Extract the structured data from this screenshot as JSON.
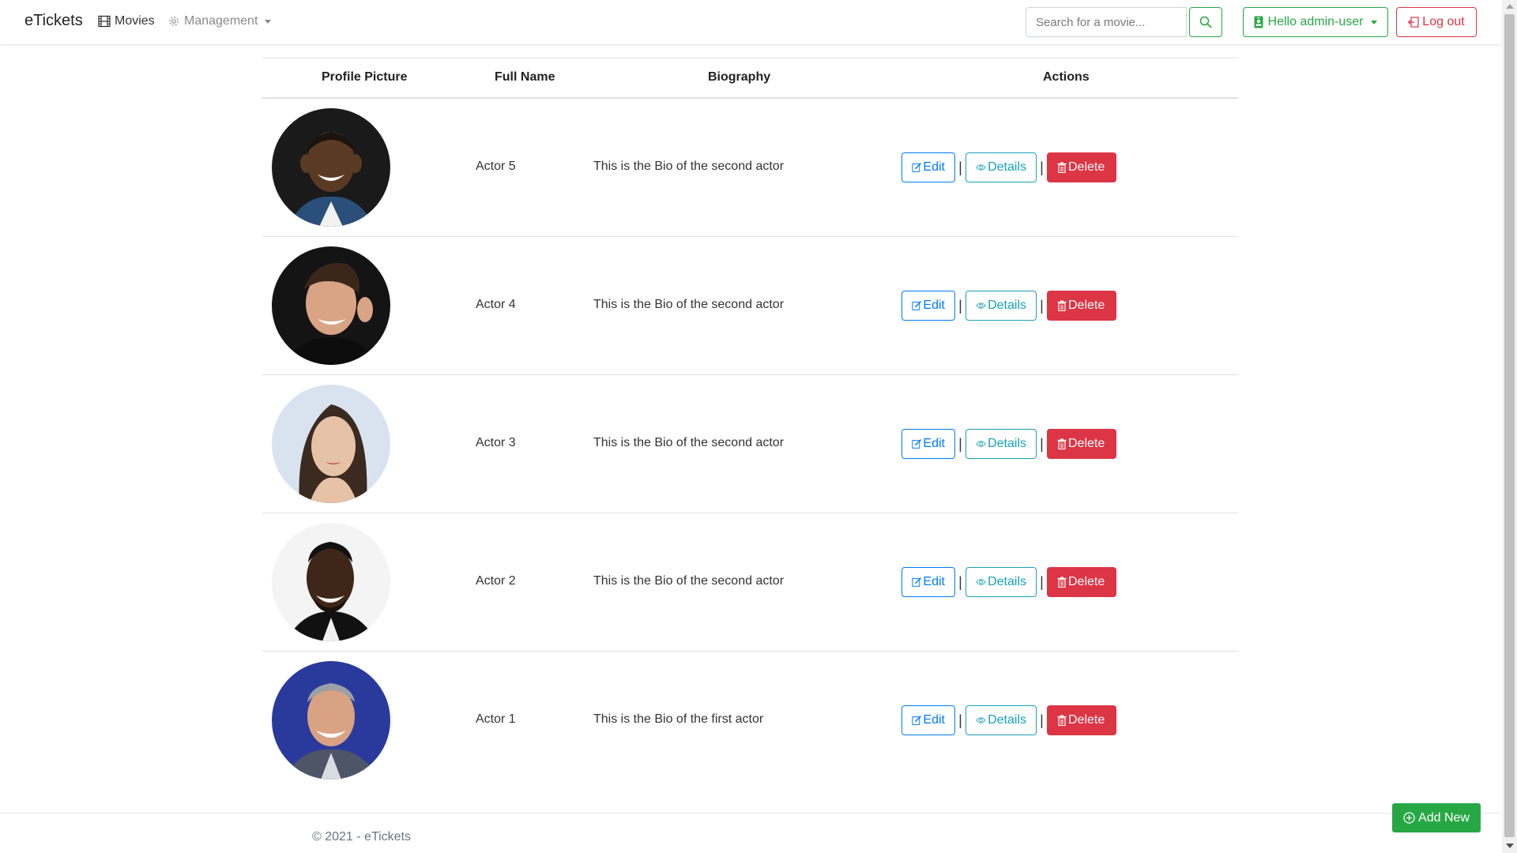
{
  "nav": {
    "brand": "eTickets",
    "movies_label": "Movies",
    "management_label": "Management",
    "search_placeholder": "Search for a movie...",
    "user_label": "Hello admin-user",
    "logout_label": "Log out"
  },
  "table": {
    "headers": [
      "Profile Picture",
      "Full Name",
      "Biography",
      "Actions"
    ],
    "rows": [
      {
        "name": "Actor 5",
        "bio": "This is the Bio of the second actor"
      },
      {
        "name": "Actor 4",
        "bio": "This is the Bio of the second actor"
      },
      {
        "name": "Actor 3",
        "bio": "This is the Bio of the second actor"
      },
      {
        "name": "Actor 2",
        "bio": "This is the Bio of the second actor"
      },
      {
        "name": "Actor 1",
        "bio": "This is the Bio of the first actor"
      }
    ],
    "action_labels": {
      "edit": "Edit",
      "details": "Details",
      "delete": "Delete",
      "separator": "|"
    }
  },
  "footer": {
    "copyright": "© 2021 - eTickets",
    "add_new_label": "Add New"
  },
  "colors": {
    "success": "#28a745",
    "danger": "#dc3545",
    "primary": "#007bff",
    "info": "#17a2b8"
  },
  "icons": {
    "movies": "film-icon",
    "management": "gear-icon",
    "search": "search-icon",
    "user": "person-badge-icon",
    "logout": "box-arrow-left-icon",
    "edit": "pencil-square-icon",
    "details": "eye-icon",
    "delete": "trash-icon",
    "add": "plus-circle-icon"
  }
}
